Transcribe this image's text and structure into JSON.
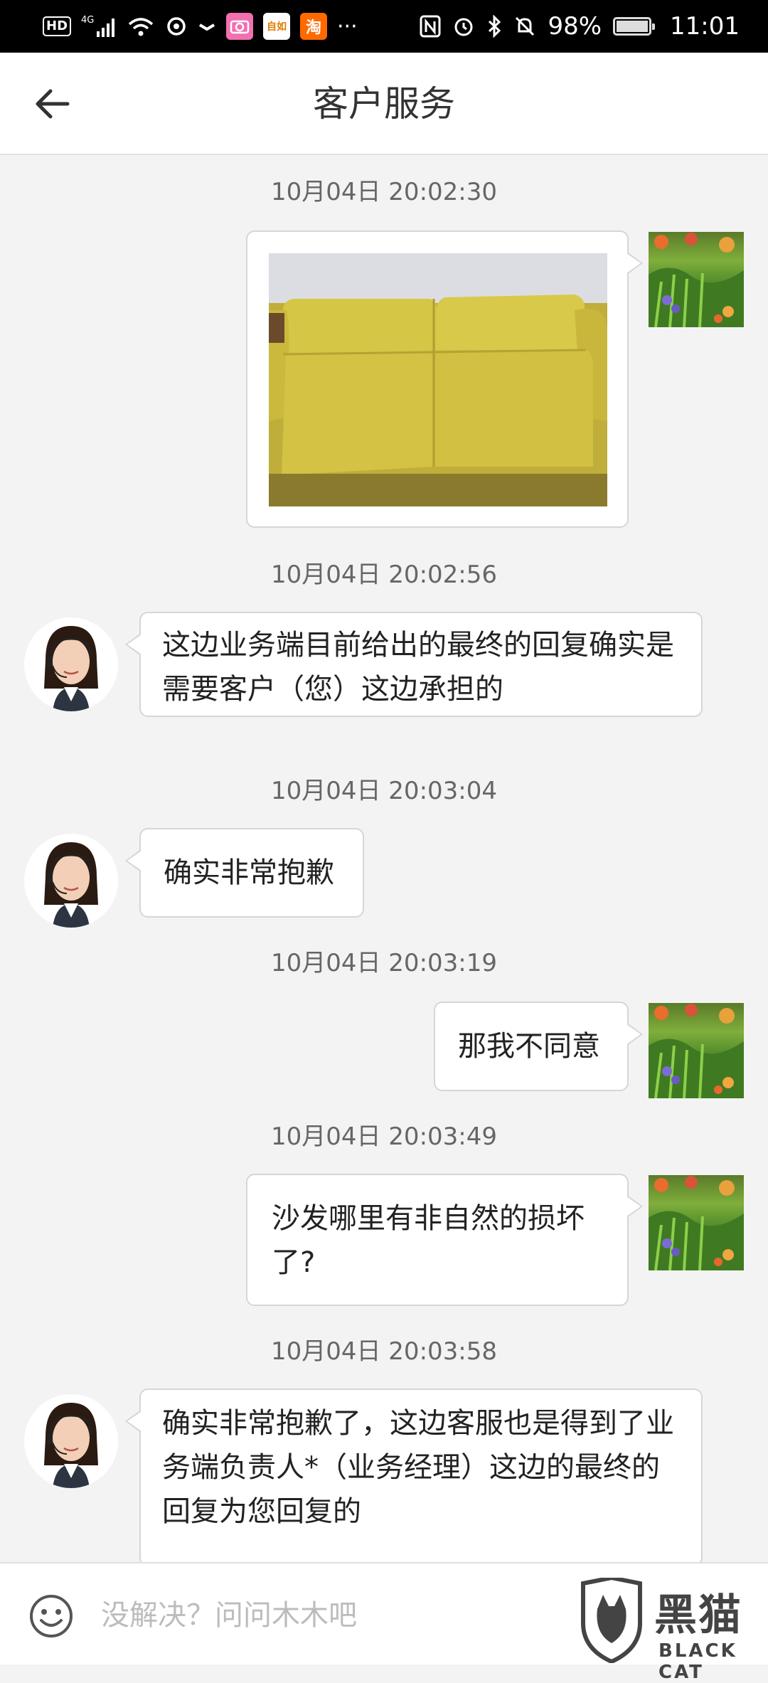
{
  "status_bar": {
    "hd": "HD",
    "network": "4G",
    "app_label_1": "自如",
    "app_label_2": "淘",
    "overflow": "···",
    "battery": "98%",
    "time": "11:01"
  },
  "header": {
    "title": "客户服务"
  },
  "messages": [
    {
      "time": "10月04日 20:02:30",
      "sender": "user",
      "type": "image"
    },
    {
      "time": "10月04日 20:02:56",
      "sender": "agent",
      "text": "这边业务端目前给出的最终的回复确实是需要客户（您）这边承担的"
    },
    {
      "time": "10月04日 20:03:04",
      "sender": "agent",
      "text": "确实非常抱歉"
    },
    {
      "time": "10月04日 20:03:19",
      "sender": "user",
      "text": "那我不同意"
    },
    {
      "time": "10月04日 20:03:49",
      "sender": "user",
      "text": "沙发哪里有非自然的损坏了?"
    },
    {
      "time": "10月04日 20:03:58",
      "sender": "agent",
      "text": "确实非常抱歉了，这边客服也是得到了业务端负责人*（业务经理）这边的最终的回复为您回复的"
    }
  ],
  "input": {
    "placeholder": "没解决？问问木木吧"
  },
  "watermark": {
    "logo_text": "黑猫",
    "logo_sub": "BLACK CAT"
  },
  "colors": {
    "status_bar_bg": "#000000",
    "chat_bg": "#f3f3f3",
    "bubble_bg": "#ffffff",
    "bubble_border": "#d6d6d6",
    "timestamp": "#666666",
    "sofa_yellow": "#d4c43e"
  }
}
